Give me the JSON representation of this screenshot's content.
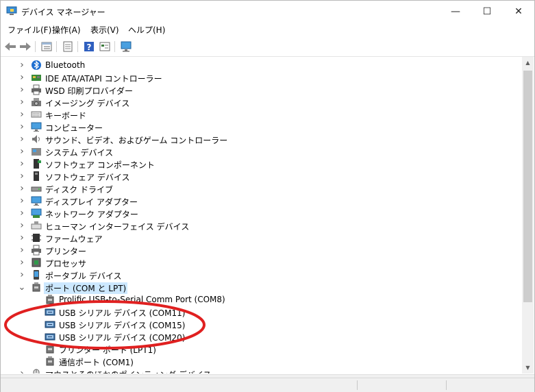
{
  "window": {
    "title": "デバイス マネージャー",
    "minimize_glyph": "—",
    "maximize_glyph": "☐",
    "close_glyph": "✕"
  },
  "menu": [
    "ファイル(F)",
    "操作(A)",
    "表示(V)",
    "ヘルプ(H)"
  ],
  "tree": {
    "categories": [
      {
        "label": "Bluetooth",
        "icon": "bluetooth-icon",
        "expanded": false
      },
      {
        "label": "IDE ATA/ATAPI コントローラー",
        "icon": "ide-controller-icon",
        "expanded": false
      },
      {
        "label": "WSD 印刷プロバイダー",
        "icon": "printer-provider-icon",
        "expanded": false
      },
      {
        "label": "イメージング デバイス",
        "icon": "camera-icon",
        "expanded": false
      },
      {
        "label": "キーボード",
        "icon": "keyboard-icon",
        "expanded": false
      },
      {
        "label": "コンピューター",
        "icon": "monitor-icon",
        "expanded": false
      },
      {
        "label": "サウンド、ビデオ、およびゲーム コントローラー",
        "icon": "speaker-icon",
        "expanded": false
      },
      {
        "label": "システム デバイス",
        "icon": "system-folder-icon",
        "expanded": false
      },
      {
        "label": "ソフトウェア コンポーネント",
        "icon": "software-component-icon",
        "expanded": false
      },
      {
        "label": "ソフトウェア デバイス",
        "icon": "software-device-icon",
        "expanded": false
      },
      {
        "label": "ディスク ドライブ",
        "icon": "disk-drive-icon",
        "expanded": false
      },
      {
        "label": "ディスプレイ アダプター",
        "icon": "display-adapter-icon",
        "expanded": false
      },
      {
        "label": "ネットワーク アダプター",
        "icon": "network-adapter-icon",
        "expanded": false
      },
      {
        "label": "ヒューマン インターフェイス デバイス",
        "icon": "hid-icon",
        "expanded": false
      },
      {
        "label": "ファームウェア",
        "icon": "firmware-icon",
        "expanded": false
      },
      {
        "label": "プリンター",
        "icon": "printer-icon",
        "expanded": false
      },
      {
        "label": "プロセッサ",
        "icon": "processor-icon",
        "expanded": false
      },
      {
        "label": "ポータブル デバイス",
        "icon": "portable-device-icon",
        "expanded": false
      },
      {
        "label": "ポート (COM と LPT)",
        "icon": "port-icon",
        "expanded": true,
        "selected": true
      }
    ],
    "ports": [
      {
        "label": "Prolific USB-to-Serial Comm Port (COM8)",
        "icon": "port-icon"
      },
      {
        "label": "USB シリアル デバイス (COM11)",
        "icon": "usb-serial-icon"
      },
      {
        "label": "USB シリアル デバイス (COM15)",
        "icon": "usb-serial-icon"
      },
      {
        "label": "USB シリアル デバイス (COM20)",
        "icon": "usb-serial-icon"
      },
      {
        "label": "プリンター ポート (LPT1)",
        "icon": "port-icon"
      },
      {
        "label": "通信ポート (COM1)",
        "icon": "port-icon"
      }
    ],
    "after": [
      {
        "label": "マウスとそのほかのポインティング デバイス",
        "icon": "mouse-icon",
        "expanded": false
      }
    ]
  },
  "colors": {
    "selection": "#cce8ff",
    "annotation": "#e02020"
  }
}
